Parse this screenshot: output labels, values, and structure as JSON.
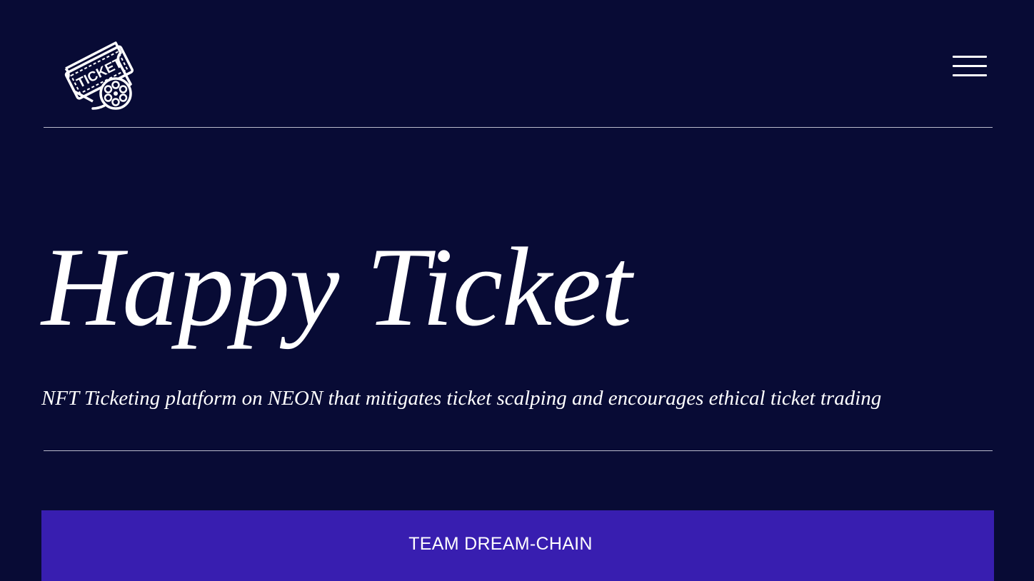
{
  "header": {
    "logo": {
      "icon": "ticket-logo-icon",
      "text": "TICKET"
    },
    "menu": {
      "icon": "hamburger-menu-icon"
    }
  },
  "hero": {
    "title": "Happy Ticket",
    "tagline": "NFT Ticketing platform on NEON that mitigates ticket scalping and encourages ethical ticket trading"
  },
  "team": {
    "label": "TEAM DREAM-CHAIN"
  },
  "colors": {
    "background": "#080b35",
    "accent_bar": "#381eb0",
    "text": "#ffffff",
    "divider": "#b9bbcc"
  }
}
